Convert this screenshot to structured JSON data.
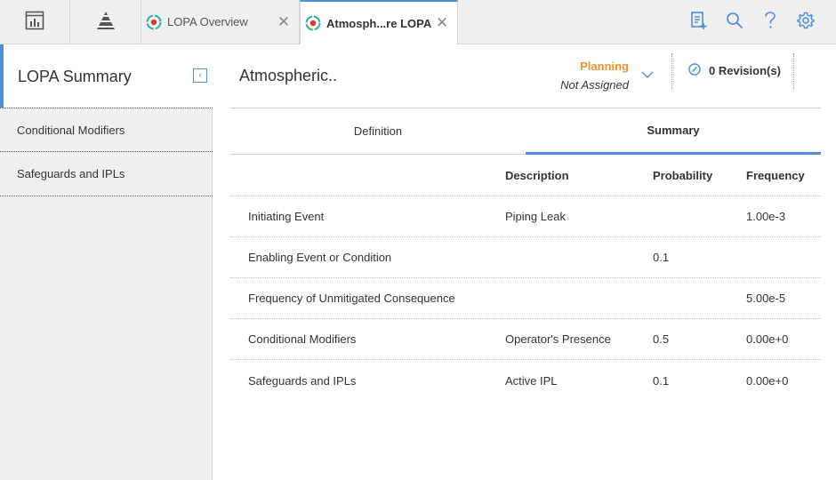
{
  "topbar": {
    "dashboard_icon": "dashboard-icon",
    "pyramid_icon": "pyramid-icon",
    "tabs": [
      {
        "label": "LOPA Overview",
        "icon": "lopa-icon",
        "active": false
      },
      {
        "label": "Atmosph...re LOPA",
        "icon": "lopa-icon",
        "active": true
      }
    ],
    "right_icons": [
      "add-document-icon",
      "search-icon",
      "help-icon",
      "gear-icon"
    ]
  },
  "sidebar": {
    "title": "LOPA Summary",
    "items": [
      {
        "label": "Conditional Modifiers"
      },
      {
        "label": "Safeguards and IPLs"
      }
    ]
  },
  "main": {
    "title": "Atmospheric..",
    "state": {
      "name": "Planning",
      "assignee": "Not Assigned"
    },
    "revisions": "0 Revision(s)",
    "subtabs": [
      {
        "label": "Definition",
        "active": false
      },
      {
        "label": "Summary",
        "active": true
      }
    ],
    "table": {
      "headers": {
        "name": "",
        "description": "Description",
        "probability": "Probability",
        "frequency": "Frequency"
      },
      "rows": [
        {
          "name": "Initiating Event",
          "description": "Piping Leak",
          "probability": "",
          "frequency": "1.00e-3"
        },
        {
          "name": "Enabling Event or Condition",
          "description": "",
          "probability": "0.1",
          "frequency": ""
        },
        {
          "name": "Frequency of Unmitigated Consequence",
          "description": "",
          "probability": "",
          "frequency": "5.00e-5"
        },
        {
          "name": "Conditional Modifiers",
          "description": "Operator's Presence",
          "probability": "0.5",
          "frequency": "0.00e+0"
        },
        {
          "name": "Safeguards and IPLs",
          "description": "Active IPL",
          "probability": "0.1",
          "frequency": "0.00e+0"
        }
      ]
    }
  },
  "colors": {
    "accent": "#4a90d9",
    "state": "#f0902a",
    "lopa_teal": "#2ab3a6",
    "lopa_red": "#e0362c"
  }
}
